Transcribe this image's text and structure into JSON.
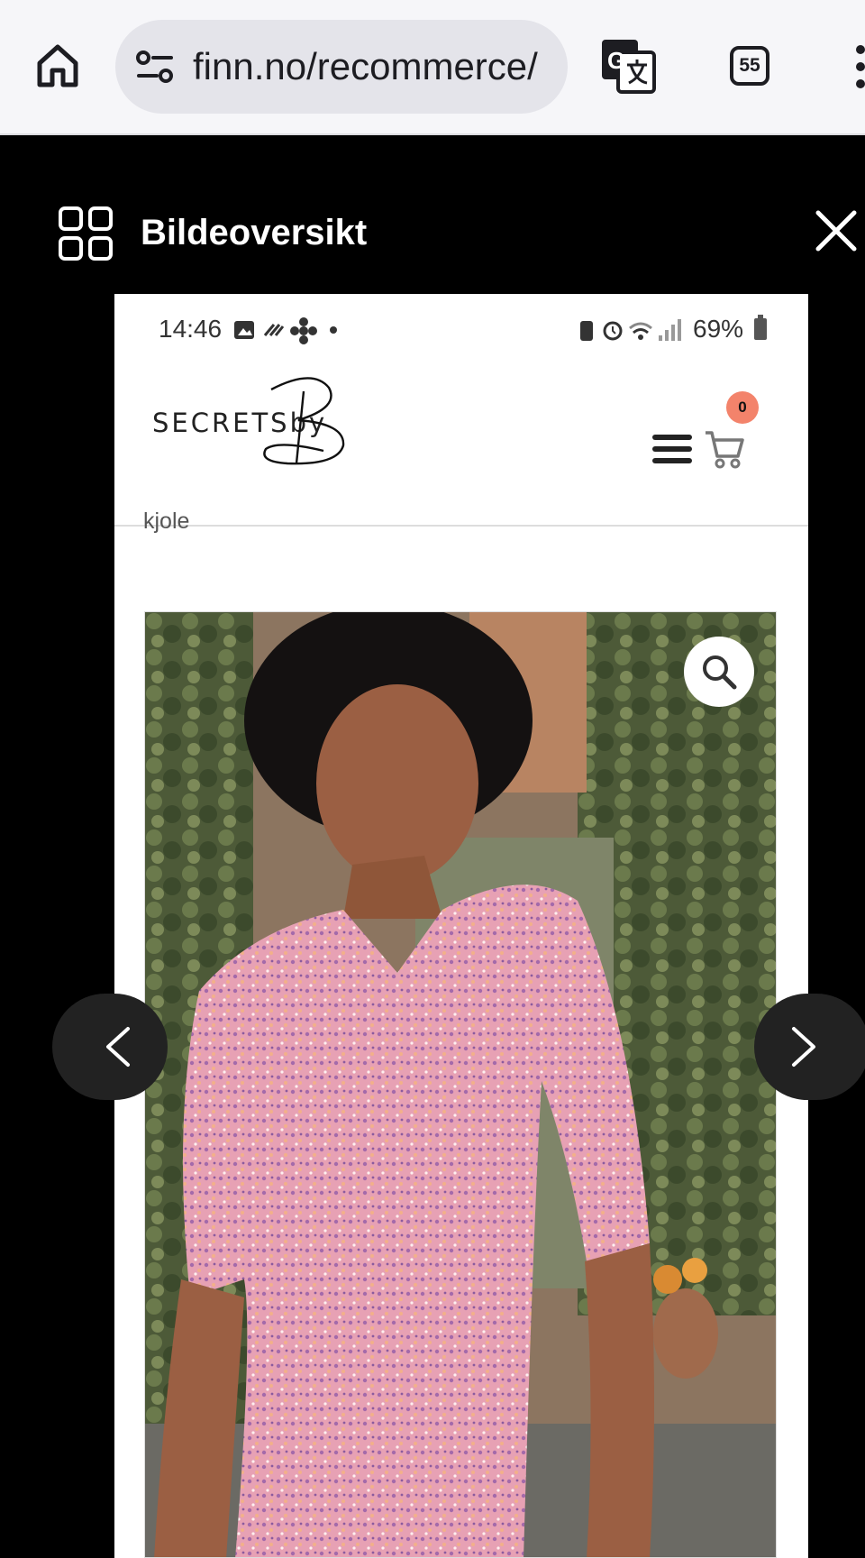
{
  "browser": {
    "url": "finn.no/recommerce/",
    "tab_count": "55"
  },
  "gallery": {
    "title": "Bildeoversikt"
  },
  "screenshot": {
    "status_bar": {
      "time": "14:46",
      "battery_percent": "69%"
    },
    "site": {
      "brand": "SECRETSby",
      "cart_count": "0",
      "category": "kjole"
    }
  },
  "icons": {
    "home": "home-icon",
    "site_settings": "tune-icon",
    "translate": "translate-icon",
    "tabs": "tabs-icon",
    "menu": "more-vert-icon",
    "grid": "grid-icon",
    "close": "close-icon",
    "zoom": "search-icon",
    "prev": "chevron-left-icon",
    "next": "chevron-right-icon",
    "cart": "cart-icon",
    "hamburger": "hamburger-icon"
  },
  "colors": {
    "badge": "#f3836b",
    "overlay": "#000000"
  }
}
